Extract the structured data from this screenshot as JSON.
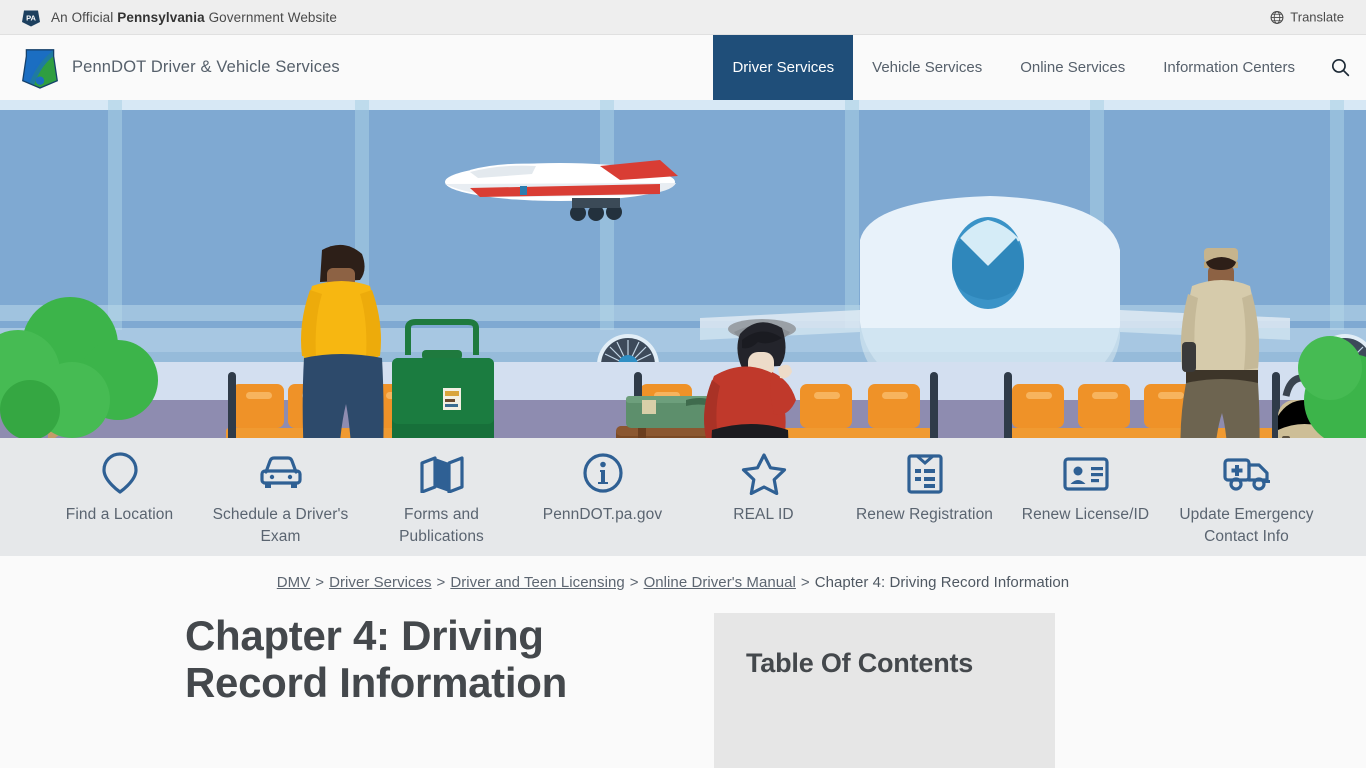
{
  "gov_bar": {
    "keystone_icon": "pa-keystone-icon",
    "text_before": "An Official ",
    "text_bold": "Pennsylvania",
    "text_after": " Government Website",
    "translate_label": "Translate",
    "translate_icon": "globe-icon"
  },
  "header": {
    "logo_icon": "penndot-keystone-logo",
    "brand": "PennDOT Driver & Vehicle Services",
    "search_icon": "search-icon",
    "nav": [
      {
        "label": "Driver Services",
        "active": true
      },
      {
        "label": "Vehicle Services",
        "active": false
      },
      {
        "label": "Online Services",
        "active": false
      },
      {
        "label": "Information Centers",
        "active": false
      }
    ]
  },
  "hero": {
    "alt": "Illustration of travelers with luggage waiting at an airport terminal window with airplanes outside"
  },
  "quicklinks": [
    {
      "label": "Find a Location",
      "icon": "map-pin-icon"
    },
    {
      "label": "Schedule a Driver's Exam",
      "icon": "car-icon"
    },
    {
      "label": "Forms and Publications",
      "icon": "folded-map-icon"
    },
    {
      "label": "PennDOT.pa.gov",
      "icon": "info-circle-icon"
    },
    {
      "label": "REAL ID",
      "icon": "star-icon"
    },
    {
      "label": "Renew Registration",
      "icon": "document-list-icon"
    },
    {
      "label": "Renew License/ID",
      "icon": "id-card-icon"
    },
    {
      "label": "Update Emergency Contact Info",
      "icon": "ambulance-icon"
    }
  ],
  "breadcrumb": {
    "items": [
      {
        "label": "DMV",
        "link": true
      },
      {
        "label": "Driver Services",
        "link": true
      },
      {
        "label": "Driver and Teen Licensing",
        "link": true
      },
      {
        "label": "Online Driver's Manual",
        "link": true
      },
      {
        "label": "Chapter 4: Driving Record Information",
        "link": false
      }
    ],
    "separator": ">"
  },
  "main": {
    "page_title": "Chapter 4: Driving Record Information"
  },
  "sidebar": {
    "toc_title": "Table Of Contents",
    "toc_items": []
  },
  "colors": {
    "nav_active_bg": "#1f4e79",
    "icon_blue": "#2f6094",
    "band_bg": "#e6e8ea",
    "toc_bg": "#e6e6e6",
    "text_gray": "#5a6470",
    "heading_gray": "#44484c"
  }
}
